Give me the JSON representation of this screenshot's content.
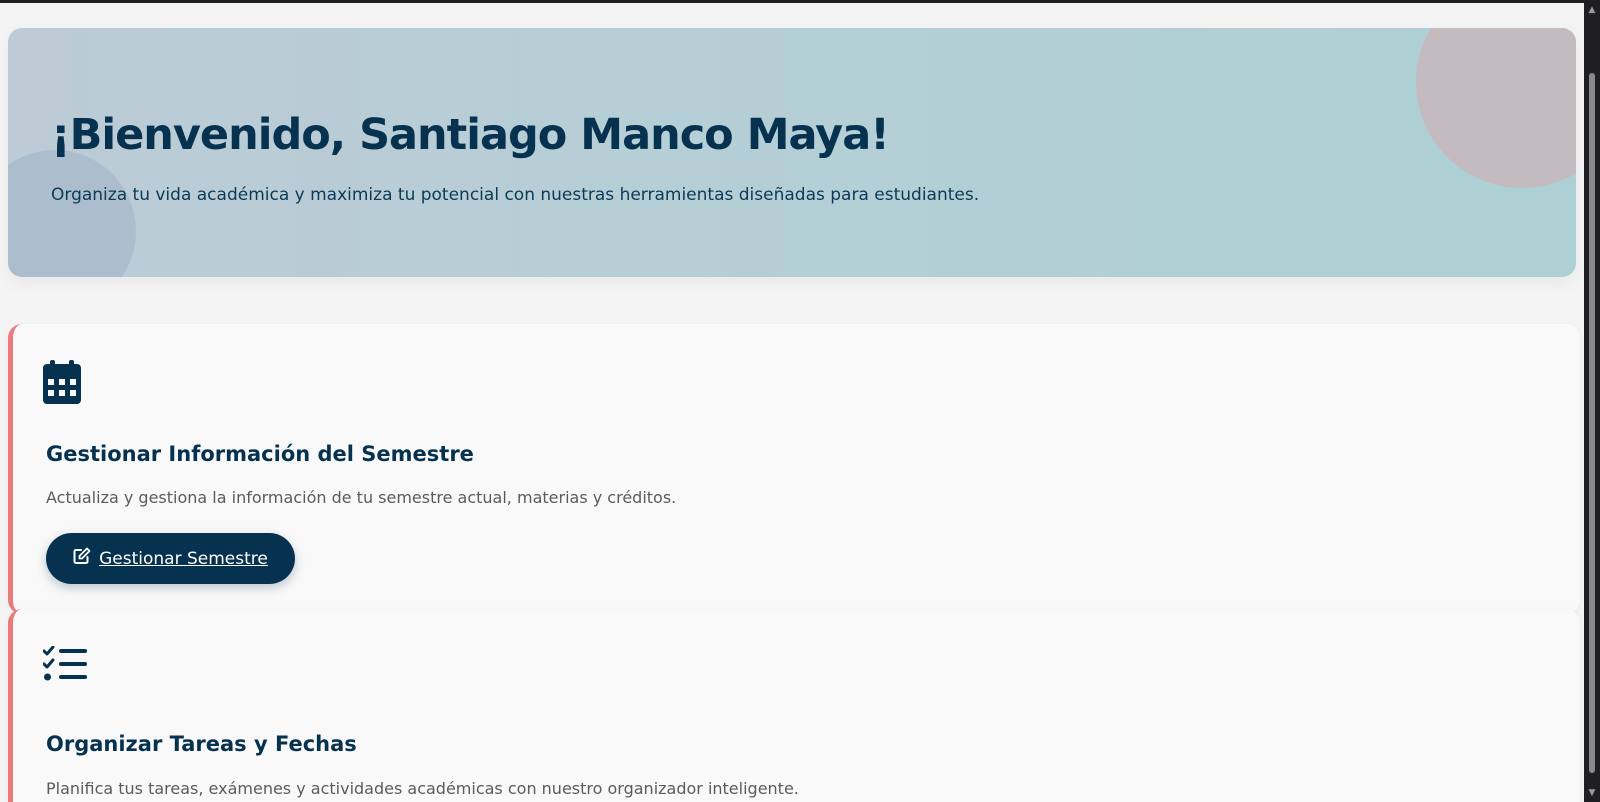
{
  "hero": {
    "title": "¡Bienvenido, Santiago Manco Maya!",
    "subtitle": "Organiza tu vida académica y maximiza tu potencial con nuestras herramientas diseñadas para estudiantes."
  },
  "cards": [
    {
      "icon": "calendar-icon",
      "title": "Gestionar Información del Semestre",
      "description": "Actualiza y gestiona la información de tu semestre actual, materias y créditos.",
      "button": {
        "icon": "edit-icon",
        "label": "Gestionar Semestre"
      }
    },
    {
      "icon": "task-list-icon",
      "title": "Organizar Tareas y Fechas",
      "description": "Planifica tus tareas, exámenes y actividades académicas con nuestro organizador inteligente."
    }
  ],
  "colors": {
    "primary": "#06324f",
    "accent_border": "#e87b7b",
    "hero_start": "#bccbd6",
    "hero_end": "#acd0d3"
  }
}
